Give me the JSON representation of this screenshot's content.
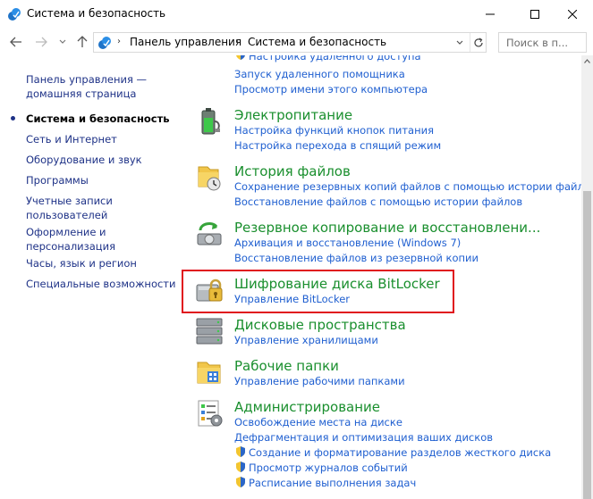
{
  "window": {
    "title": "Система и безопасность",
    "app_icon": "control-panel-icon"
  },
  "address": {
    "crumbs": [
      "Панель управления",
      "Система и безопасность"
    ],
    "search_placeholder": "Поиск в п..."
  },
  "left_nav": {
    "items": [
      {
        "label": "Панель управления —",
        "label2": "домашняя страница"
      },
      {
        "label": "Система и безопасность",
        "current": true
      },
      {
        "label": "Сеть и Интернет"
      },
      {
        "label": "Оборудование и звук"
      },
      {
        "label": "Программы"
      },
      {
        "label": "Учетные записи",
        "label2": "пользователей"
      },
      {
        "label": "Оформление и",
        "label2": "персонализация"
      },
      {
        "label": "Часы, язык и регион"
      },
      {
        "label": "Специальные возможности"
      }
    ]
  },
  "categories": [
    {
      "partial_links": [
        "Настройка удаленного доступа",
        "Запуск удаленного помощника",
        "Просмотр имени этого компьютера"
      ]
    },
    {
      "title": "Электропитание",
      "icon": "battery-icon",
      "links": [
        "Настройка функций кнопок питания",
        "Настройка перехода в спящий режим"
      ]
    },
    {
      "title": "История файлов",
      "icon": "file-history-icon",
      "links": [
        "Сохранение резервных копий файлов с помощью истории файлов",
        "Восстановление файлов с помощью истории файлов"
      ]
    },
    {
      "title": "Резервное копирование и восстановлени...",
      "icon": "backup-restore-icon",
      "links": [
        "Архивация и восстановление (Windows 7)",
        "Восстановление файлов из резервной копии"
      ]
    },
    {
      "title": "Шифрование диска BitLocker",
      "icon": "bitlocker-icon",
      "links": [
        "Управление BitLocker"
      ]
    },
    {
      "title": "Дисковые пространства",
      "icon": "storage-spaces-icon",
      "links": [
        "Управление хранилищами"
      ]
    },
    {
      "title": "Рабочие папки",
      "icon": "work-folders-icon",
      "links": [
        "Управление рабочими папками"
      ]
    },
    {
      "title": "Администрирование",
      "icon": "admin-tools-icon",
      "links": [
        "Освобождение места на диске",
        "Дефрагментация и оптимизация ваших дисков"
      ],
      "shield_links": [
        "Создание и форматирование разделов жесткого диска",
        "Просмотр журналов событий",
        "Расписание выполнения задач"
      ]
    }
  ],
  "colors": {
    "category_title": "#1a8f2e",
    "link": "#1f5fd0",
    "nav_link": "#1e3287",
    "highlight": "#e0121d"
  }
}
